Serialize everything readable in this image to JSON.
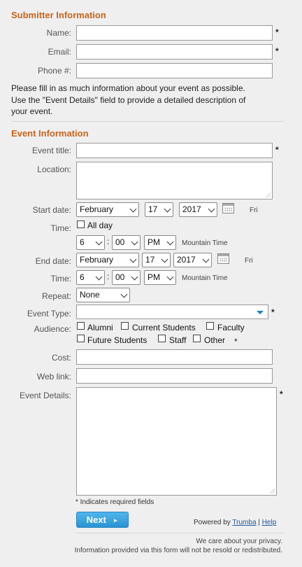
{
  "submitter": {
    "title": "Submitter Information",
    "name_label": "Name:",
    "email_label": "Email:",
    "phone_label": "Phone #:",
    "required_mark": "*",
    "instructions_line1": "Please fill in as much information about your event as possible.",
    "instructions_line2": "Use the \"Event Details\" field to provide a detailed description of",
    "instructions_line3": "your event."
  },
  "event": {
    "title": "Event Information",
    "event_title_label": "Event title:",
    "location_label": "Location:",
    "start_date_label": "Start date:",
    "start_month": "February",
    "start_day": "17",
    "start_year": "2017",
    "start_weekday": "Fri",
    "time_label": "Time:",
    "all_day_label": "All day",
    "start_hour": "6",
    "start_minute": "00",
    "start_ampm": "PM",
    "time_sep": ":",
    "timezone": "Mountain Time",
    "end_date_label": "End date:",
    "end_month": "February",
    "end_day": "17",
    "end_year": "2017",
    "end_weekday": "Fri",
    "end_time_label": "Time:",
    "end_hour": "6",
    "end_minute": "00",
    "end_ampm": "PM",
    "repeat_label": "Repeat:",
    "repeat_value": "None",
    "event_type_label": "Event Type:",
    "audience_label": "Audience:",
    "audience_options": [
      "Alumni",
      "Current Students",
      "Faculty",
      "Future Students",
      "Staff",
      "Other"
    ],
    "cost_label": "Cost:",
    "weblink_label": "Web link:",
    "details_label": "Event Details:",
    "required_note": "* Indicates required fields"
  },
  "footer": {
    "next_label": "Next",
    "powered_by": "Powered by",
    "trumba_link": "Trumba",
    "separator": "|",
    "help_link": "Help",
    "privacy_line1": "We care about your privacy.",
    "privacy_line2": "Information provided via this form will not be resold or redistributed."
  },
  "colors": {
    "section_title": "#c8641a",
    "button": "#2a93d3",
    "dropdown_arrow": "#1a7fc1"
  }
}
